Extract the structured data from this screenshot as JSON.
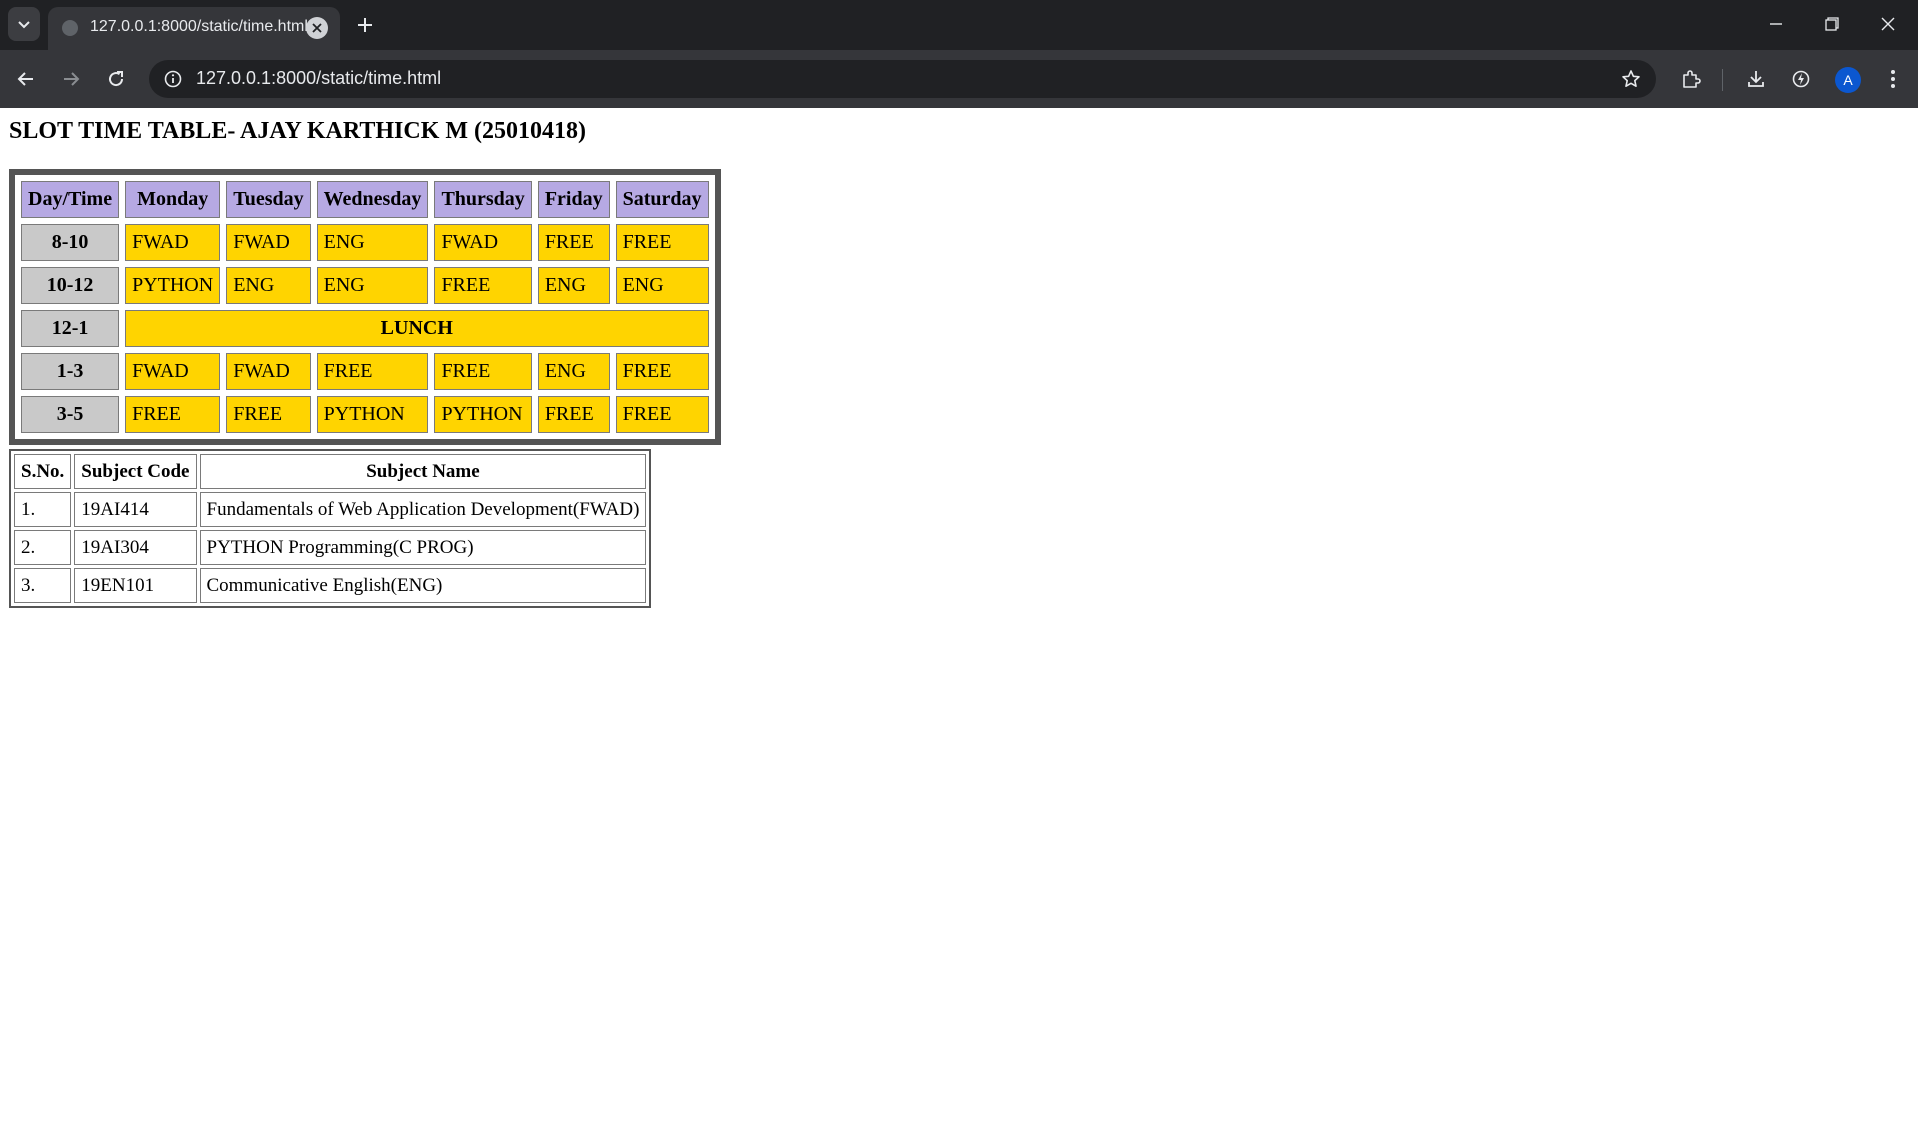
{
  "browser": {
    "tab_title": "127.0.0.1:8000/static/time.html",
    "url": "127.0.0.1:8000/static/time.html",
    "avatar_initial": "A",
    "icons": [
      "tab-search-icon",
      "site-favicon-icon",
      "close-tab-icon",
      "new-tab-icon",
      "minimize-icon",
      "restore-icon",
      "close-window-icon",
      "back-arrow-icon",
      "forward-arrow-icon",
      "reload-icon",
      "site-info-icon",
      "bookmark-star-icon",
      "extensions-icon",
      "download-icon",
      "performance-icon",
      "kebab-menu-icon"
    ]
  },
  "page": {
    "title": "SLOT TIME TABLE- AJAY KARTHICK M (25010418)"
  },
  "timetable": {
    "headers": [
      "Day/Time",
      "Monday",
      "Tuesday",
      "Wednesday",
      "Thursday",
      "Friday",
      "Saturday"
    ],
    "rows": [
      {
        "time": "8-10",
        "slots": [
          "FWAD",
          "FWAD",
          "ENG",
          "FWAD",
          "FREE",
          "FREE"
        ]
      },
      {
        "time": "10-12",
        "slots": [
          "PYTHON",
          "ENG",
          "ENG",
          "FREE",
          "ENG",
          "ENG"
        ]
      },
      {
        "time": "12-1",
        "lunch": "LUNCH"
      },
      {
        "time": "1-3",
        "slots": [
          "FWAD",
          "FWAD",
          "FREE",
          "FREE",
          "ENG",
          "FREE"
        ]
      },
      {
        "time": "3-5",
        "slots": [
          "FREE",
          "FREE",
          "PYTHON",
          "PYTHON",
          "FREE",
          "FREE"
        ]
      }
    ],
    "colors": {
      "header": "#b6a9e3",
      "time": "#c9c9c9",
      "slot": "#ffd400",
      "border": "#555555"
    }
  },
  "subjects": {
    "headers": [
      "S.No.",
      "Subject Code",
      "Subject Name"
    ],
    "rows": [
      [
        "1.",
        "19AI414",
        "Fundamentals of Web Application Development(FWAD)"
      ],
      [
        "2.",
        "19AI304",
        "PYTHON Programming(C PROG)"
      ],
      [
        "3.",
        "19EN101",
        "Communicative English(ENG)"
      ]
    ]
  }
}
